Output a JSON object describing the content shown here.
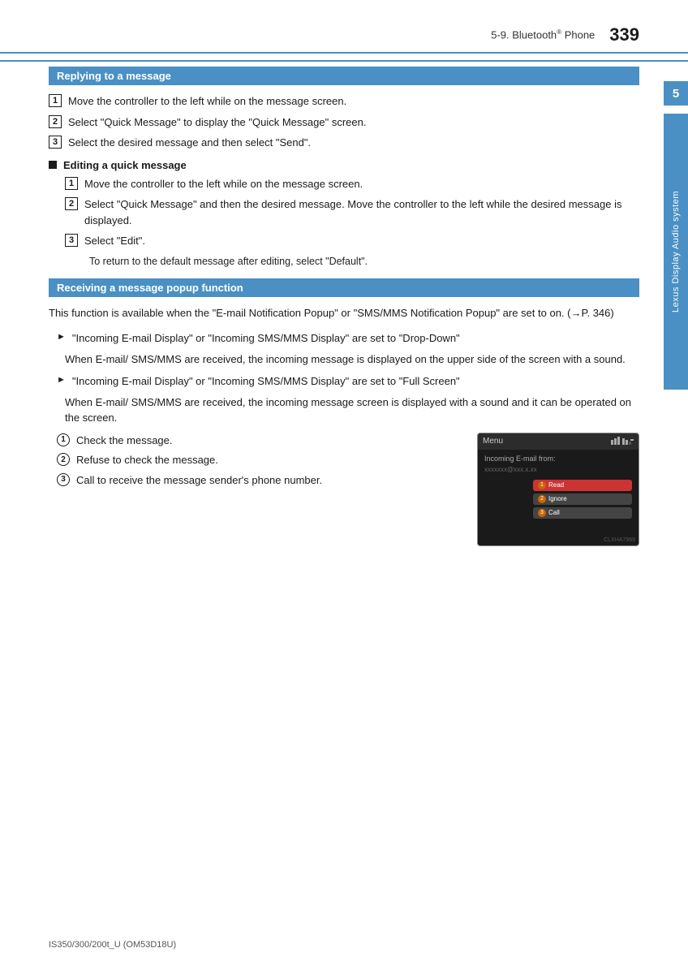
{
  "header": {
    "chapter": "5-9. Bluetooth® Phone",
    "chapter_pre": "5-9. Bluetooth",
    "chapter_sup": "®",
    "chapter_post": " Phone",
    "page_number": "339"
  },
  "section1": {
    "title": "Replying to a message",
    "steps": [
      "Move the controller to the left while on the message screen.",
      "Select \"Quick Message\" to display the \"Quick Message\" screen.",
      "Select the desired message and then select \"Send\"."
    ],
    "subsection": {
      "title": "Editing a quick message",
      "steps": [
        "Move the controller to the left while on the message screen.",
        "Select \"Quick Message\" and then the desired message. Move the controller to the left while the desired message is displayed.",
        "Select \"Edit\"."
      ],
      "note": "To return to the default message after editing, select \"Default\"."
    }
  },
  "section2": {
    "title": "Receiving a message popup function",
    "intro": "This function is available when the \"E-mail Notification Popup\" or \"SMS/MMS Notification Popup\" are set to on. (→P. 346)",
    "bullet1": {
      "label": "\"Incoming E-mail Display\" or \"Incoming SMS/MMS Display\" are set to \"Drop-Down\"",
      "detail": "When E-mail/ SMS/MMS are received, the incoming message is displayed on the upper side of the screen with a sound."
    },
    "bullet2": {
      "label": "\"Incoming E-mail Display\" or \"Incoming SMS/MMS Display\" are set to \"Full Screen\"",
      "detail": "When E-mail/ SMS/MMS are received, the incoming message screen is displayed with a sound and it can be operated on the screen."
    },
    "circle_items": [
      "Check the message.",
      "Refuse to check the message.",
      "Call to receive the message sender's phone number."
    ]
  },
  "screen": {
    "menu_label": "Menu",
    "signal_icons": "↑↓ ∥",
    "incoming_label": "Incoming E-mail from:",
    "email_value": "xxxxxxx@xxx.x.xx",
    "read_btn": "Read",
    "ignore_btn": "Ignore",
    "call_btn": "Call",
    "image_code": "CLXHA7969"
  },
  "sidebar": {
    "number": "5",
    "text": "Lexus Display Audio system"
  },
  "footer": {
    "text": "IS350/300/200t_U (OM53D18U)"
  }
}
